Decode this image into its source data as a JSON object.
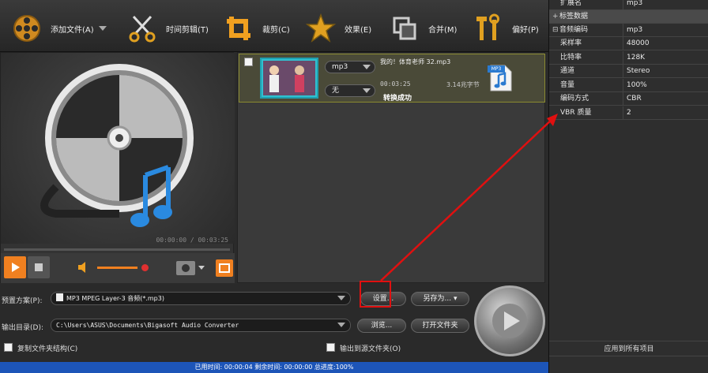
{
  "toolbar": {
    "add_file": "添加文件(A)",
    "trim": "时间剪辑(T)",
    "crop": "裁剪(C)",
    "effect": "效果(E)",
    "merge": "合并(M)",
    "preferences": "偏好(P)"
  },
  "preview": {
    "time": "00:00:00 / 00:03:25",
    "volume_level": 0.8
  },
  "file": {
    "title": "我的！体育老师 32.mp3",
    "format": "mp3",
    "subtitle": "无",
    "duration": "00:03:25",
    "size": "3.14兆字节",
    "status": "转换成功",
    "badge": "MP3"
  },
  "bottom": {
    "profile_label": "预置方案(P):",
    "profile_value": "MP3 MPEG Layer-3 音频(*.mp3)",
    "settings": "设置...",
    "save_as": "另存为...",
    "output_label": "输出目录(D):",
    "output_path": "C:\\Users\\ASUS\\Documents\\Bigasoft Audio Converter",
    "browse": "浏览...",
    "open_folder": "打开文件夹",
    "copy_structure": "复制文件夹结构(C)",
    "output_to_source": "输出到源文件夹(O)",
    "status": "已用时间: 00:00:04 剩余时间: 00:00:00 总进度:100%"
  },
  "props": {
    "ext_key": "扩展名",
    "ext_value": "mp3",
    "tag_category": "标签数据",
    "audio_category": "音频编码",
    "audio_value": "mp3",
    "rows": [
      {
        "k": "采样率",
        "v": "48000"
      },
      {
        "k": "比特率",
        "v": "128K"
      },
      {
        "k": "通道",
        "v": "Stereo"
      },
      {
        "k": "音量",
        "v": "100%"
      },
      {
        "k": "编码方式",
        "v": "CBR"
      },
      {
        "k": "VBR 质量",
        "v": "2"
      }
    ],
    "apply_all": "应用到所有项目",
    "toggle_plus": "+",
    "toggle_minus": "⊟"
  },
  "colors": {
    "accent_orange": "#f08020",
    "status_blue": "#1d55b8",
    "annotation_red": "#e01010"
  }
}
